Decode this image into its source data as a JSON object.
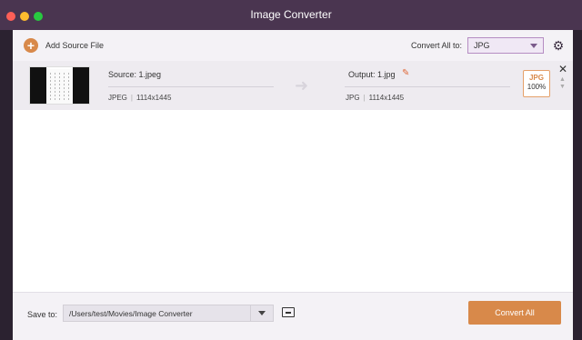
{
  "window": {
    "title": "Image Converter"
  },
  "toolbar": {
    "add_source_label": "Add Source File",
    "convert_all_label": "Convert All to:",
    "format_value": "JPG",
    "format_options": [
      "JPG"
    ]
  },
  "file": {
    "source_label": "Source: 1.jpeg",
    "source_format": "JPEG",
    "source_dimensions": "1114x1445",
    "output_label": "Output: 1.jpg",
    "output_format": "JPG",
    "output_dimensions": "1114x1445",
    "badge_format": "JPG",
    "badge_quality": "100%"
  },
  "footer": {
    "save_to_label": "Save to:",
    "save_path": "/Users/test/Movies/Image Converter",
    "convert_all_button": "Convert All"
  },
  "colors": {
    "accent": "#d8894a",
    "titlebar": "#4a3550",
    "select_border": "#b58dc2"
  }
}
